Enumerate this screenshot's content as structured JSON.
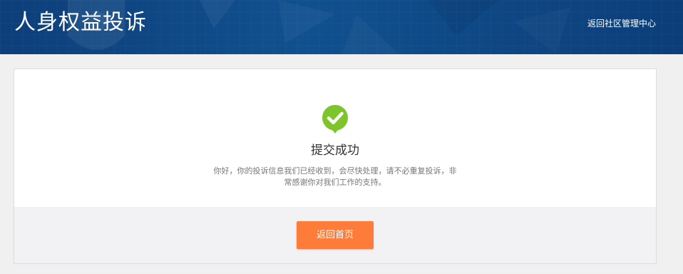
{
  "header": {
    "title": "人身权益投诉",
    "back_link": "返回社区管理中心"
  },
  "result": {
    "icon": "check-circle-icon",
    "title": "提交成功",
    "message": "你好，你的投诉信息我们已经收到，会尽快处理，请不必重复投诉，非常感谢你对我们工作的支持。"
  },
  "actions": {
    "home_button": "返回首页"
  },
  "colors": {
    "header_bg": "#10508f",
    "success_green": "#7dc52b",
    "button_orange": "#fd7c3a",
    "footer_bg": "#f2f2f4"
  }
}
